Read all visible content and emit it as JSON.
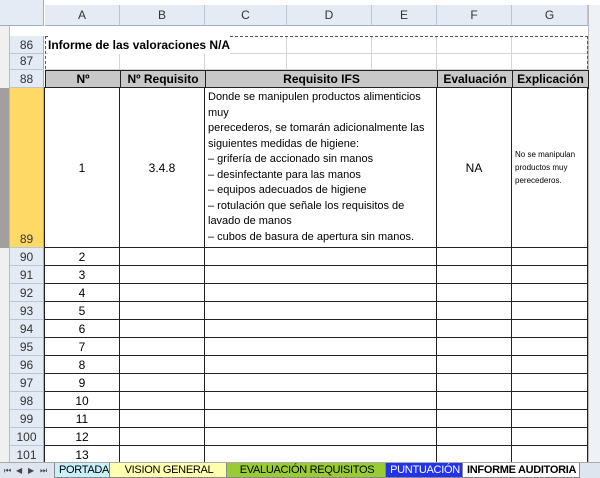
{
  "columns": [
    "A",
    "B",
    "C",
    "D",
    "E",
    "F",
    "G"
  ],
  "rows": [
    "86",
    "87",
    "88",
    "89",
    "90",
    "91",
    "92",
    "93",
    "94",
    "95",
    "96",
    "97",
    "98",
    "99",
    "100",
    "101"
  ],
  "title": "Informe de las valoraciones N/A",
  "headers": {
    "n": "Nº",
    "req": "Nº Requisito",
    "ifs": "Requisito IFS",
    "eval": "Evaluación",
    "expl": "Explicación"
  },
  "first_row": {
    "n": "1",
    "req": "3.4.8",
    "ifs_lines": [
      "Donde se manipulen productos alimenticios",
      "muy",
      "perecederos, se tomarán adicionalmente las",
      "siguientes medidas de higiene:",
      "– grifería de accionado sin manos",
      "– desinfectante para las manos",
      "– equipos adecuados de higiene",
      "– rotulación que señale los requisitos de",
      "lavado de manos",
      "– cubos de basura de apertura sin manos."
    ],
    "eval": "NA",
    "expl": "No se manipulan productos muy perecederos."
  },
  "numbers": [
    "2",
    "3",
    "4",
    "5",
    "6",
    "7",
    "8",
    "9",
    "10",
    "11",
    "12",
    "13"
  ],
  "tabs": [
    {
      "label": "PORTADA",
      "color": "#c8f0fa"
    },
    {
      "label": "VISION GENERAL",
      "color": "#ffffb0"
    },
    {
      "label": "EVALUACIÓN REQUISITOS",
      "color": "#99cc33"
    },
    {
      "label": "PUNTUACIÓN",
      "color": "#2233ee"
    },
    {
      "label": "INFORME AUDITORIA",
      "color": "#ffffff"
    }
  ],
  "selected_row_color": "#ffd966"
}
